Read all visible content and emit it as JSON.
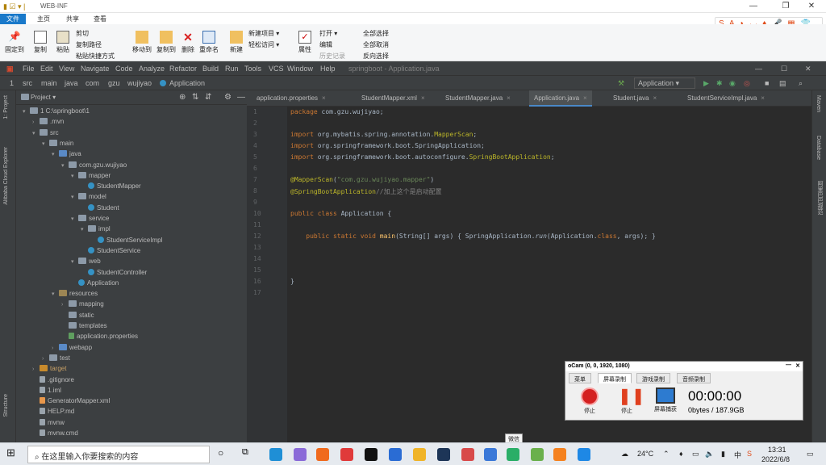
{
  "explorer": {
    "title": "WEB-INF",
    "tabs": [
      "文件",
      "主页",
      "共享",
      "查看"
    ],
    "buttons": [
      {
        "label": "固定到",
        "label2": "快速访问"
      },
      {
        "label": "复制"
      },
      {
        "label": "粘贴"
      },
      {
        "label": "移动到"
      },
      {
        "label": "复制到"
      },
      {
        "label": "删除"
      },
      {
        "label": "重命名"
      },
      {
        "label": "新建",
        "label2": "文件夹"
      },
      {
        "label": "属性"
      }
    ],
    "small": [
      "剪切",
      "复制路径",
      "粘贴快捷方式",
      "新建项目 ▾",
      "轻松访问 ▾",
      "打开 ▾",
      "编辑",
      "历史记录",
      "全部选择",
      "全部取消",
      "反向选择"
    ],
    "ime_text": "S A ◗ ◡ ♦ 🎤 ▦ 👕 ⁘"
  },
  "ide": {
    "menu": [
      "File",
      "Edit",
      "View",
      "Navigate",
      "Code",
      "Analyze",
      "Refactor",
      "Build",
      "Run",
      "Tools",
      "VCS",
      "Window",
      "Help"
    ],
    "window_title": "springboot - Application.java",
    "breadcrumb": [
      "1",
      "src",
      "main",
      "java",
      "com",
      "gzu",
      "wujiyao",
      "Application"
    ],
    "run_config": "Application",
    "project_label": "Project ▾",
    "left_strip": [
      "1: Project",
      "Alibaba Cloud Explorer",
      "Structure"
    ],
    "right_strip": [
      "Maven",
      "Database",
      "阿里巴巴规范"
    ],
    "tabs": [
      {
        "label": "application.properties",
        "active": false
      },
      {
        "label": "StudentMapper.xml",
        "active": false
      },
      {
        "label": "StudentMapper.java",
        "active": false
      },
      {
        "label": "Application.java",
        "active": true
      },
      {
        "label": "Student.java",
        "active": false
      },
      {
        "label": "StudentServiceImpl.java",
        "active": false
      }
    ],
    "inspection": "✓1",
    "tree": [
      {
        "label": "1  C:\\springboot\\1",
        "depth": 0,
        "arrow": "▾",
        "icon": "folder"
      },
      {
        "label": ".mvn",
        "depth": 1,
        "arrow": "›",
        "icon": "folder"
      },
      {
        "label": "src",
        "depth": 1,
        "arrow": "▾",
        "icon": "folder"
      },
      {
        "label": "main",
        "depth": 2,
        "arrow": "▾",
        "icon": "folder"
      },
      {
        "label": "java",
        "depth": 3,
        "arrow": "▾",
        "icon": "folder-blue"
      },
      {
        "label": "com.gzu.wujiyao",
        "depth": 4,
        "arrow": "▾",
        "icon": "folder"
      },
      {
        "label": "mapper",
        "depth": 5,
        "arrow": "▾",
        "icon": "folder"
      },
      {
        "label": "StudentMapper",
        "depth": 6,
        "arrow": "",
        "icon": "cls"
      },
      {
        "label": "model",
        "depth": 5,
        "arrow": "▾",
        "icon": "folder"
      },
      {
        "label": "Student",
        "depth": 6,
        "arrow": "",
        "icon": "cls"
      },
      {
        "label": "service",
        "depth": 5,
        "arrow": "▾",
        "icon": "folder"
      },
      {
        "label": "impl",
        "depth": 6,
        "arrow": "▾",
        "icon": "folder"
      },
      {
        "label": "StudentServiceImpl",
        "depth": 7,
        "arrow": "",
        "icon": "cls"
      },
      {
        "label": "StudentService",
        "depth": 6,
        "arrow": "",
        "icon": "cls"
      },
      {
        "label": "web",
        "depth": 5,
        "arrow": "▾",
        "icon": "folder"
      },
      {
        "label": "StudentController",
        "depth": 6,
        "arrow": "",
        "icon": "cls"
      },
      {
        "label": "Application",
        "depth": 5,
        "arrow": "",
        "icon": "cls"
      },
      {
        "label": "resources",
        "depth": 3,
        "arrow": "▾",
        "icon": "folder-res"
      },
      {
        "label": "mapping",
        "depth": 4,
        "arrow": "›",
        "icon": "folder"
      },
      {
        "label": "static",
        "depth": 4,
        "arrow": "",
        "icon": "folder"
      },
      {
        "label": "templates",
        "depth": 4,
        "arrow": "",
        "icon": "folder"
      },
      {
        "label": "application.properties",
        "depth": 4,
        "arrow": "",
        "icon": "props"
      },
      {
        "label": "webapp",
        "depth": 3,
        "arrow": "›",
        "icon": "folder-blue"
      },
      {
        "label": "test",
        "depth": 2,
        "arrow": "›",
        "icon": "folder"
      },
      {
        "label": "target",
        "depth": 1,
        "arrow": "›",
        "icon": "folder-orange"
      },
      {
        "label": ".gitignore",
        "depth": 1,
        "arrow": "",
        "icon": "file"
      },
      {
        "label": "1.iml",
        "depth": 1,
        "arrow": "",
        "icon": "file"
      },
      {
        "label": "GeneratorMapper.xml",
        "depth": 1,
        "arrow": "",
        "icon": "xml"
      },
      {
        "label": "HELP.md",
        "depth": 1,
        "arrow": "",
        "icon": "file"
      },
      {
        "label": "mvnw",
        "depth": 1,
        "arrow": "",
        "icon": "file"
      },
      {
        "label": "mvnw.cmd",
        "depth": 1,
        "arrow": "",
        "icon": "file"
      }
    ],
    "line_numbers": [
      "1",
      "2",
      "3",
      "4",
      "5",
      "6",
      "7",
      "8",
      "9",
      "10",
      "11",
      "12",
      "13",
      "14",
      "15",
      "16",
      "17"
    ],
    "code": [
      {
        "line": 1,
        "html": "<span class='kw'>package</span> com.gzu.wujiyao;"
      },
      {
        "line": 3,
        "html": "<span class='kw'>import</span> org.mybatis.spring.annotation.<span class='ann'>MapperScan</span>;"
      },
      {
        "line": 4,
        "html": "<span class='kw'>import</span> org.springframework.boot.SpringApplication;"
      },
      {
        "line": 5,
        "html": "<span class='kw'>import</span> org.springframework.boot.autoconfigure.<span class='ann'>SpringBootApplication</span>;"
      },
      {
        "line": 7,
        "html": "<span class='ann'>@MapperScan</span>(<span class='str'>\"com.gzu.wujiyao.mapper\"</span>)"
      },
      {
        "line": 8,
        "html": "<span class='ann'>@SpringBootApplication</span><span class='cmt'>//加上这个是启动配置</span>"
      },
      {
        "line": 10,
        "html": "<span class='kw'>public class</span> Application {"
      },
      {
        "line": 12,
        "html": "    <span class='kw'>public static void</span> <span class='fn'>main</span>(String[] args) { SpringApplication.<i>run</i>(Application.<span class='kw'>class</span>, args); }"
      },
      {
        "line": 16,
        "html": "}"
      }
    ]
  },
  "ocam": {
    "title": "oCam (0, 0, 1920, 1080)",
    "tabs": [
      "菜单",
      "屏幕录制",
      "游戏录制",
      "音频录制"
    ],
    "buttons": [
      "停止",
      "停止",
      "屏幕捕获"
    ],
    "time": "00:00:00",
    "size": "0bytes / 187.9GB"
  },
  "taskbar": {
    "search_placeholder": "在这里输入你要搜索的内容",
    "tooltip": "微信",
    "weather": "24°C",
    "lang": "中",
    "time": "13:31",
    "date": "2022/6/8"
  }
}
